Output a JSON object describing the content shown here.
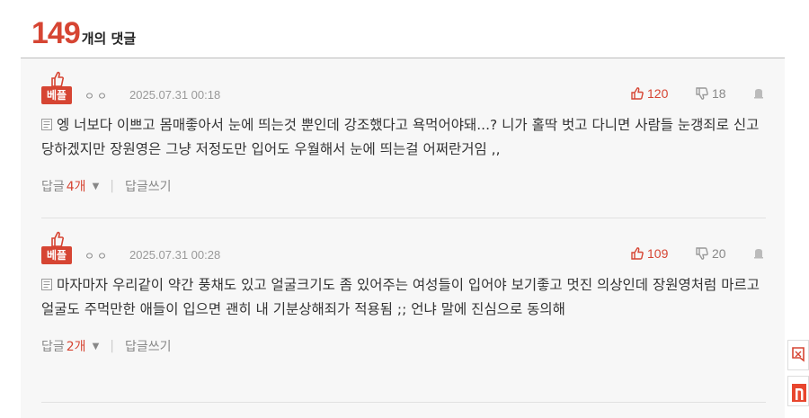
{
  "header": {
    "count": "149",
    "label": "개의 댓글"
  },
  "comments": [
    {
      "badge": "베플",
      "nickname": "ㅇㅇ",
      "date": "2025.07.31 00:18",
      "up": "120",
      "down": "18",
      "text": "엥 너보다 이쁘고 몸매좋아서 눈에 띄는것 뿐인데 강조했다고 욕먹어야돼...? 니가 홀딱 벗고 다니면 사람들 눈갱죄로 신고당하겠지만 장원영은 그냥 저정도만 입어도 우월해서 눈에 띄는걸 어쩌란거임 ,,",
      "reply_label": "답글",
      "reply_count": "4개",
      "write_label": "답글쓰기"
    },
    {
      "badge": "베플",
      "nickname": "ㅇㅇ",
      "date": "2025.07.31 00:28",
      "up": "109",
      "down": "20",
      "text": "마자마자 우리같이 약간 풍채도 있고 얼굴크기도 좀 있어주는 여성들이 입어야 보기좋고 멋진 의상인데 장원영처럼 마르고 얼굴도 주먹만한 애들이 입으면 괜히 내 기분상해죄가 적용됨 ;; 언냐 말에 진심으로 동의해",
      "reply_label": "답글",
      "reply_count": "2개",
      "write_label": "답글쓰기"
    }
  ],
  "colors": {
    "accent": "#d64533",
    "panel": "#f7f7f7",
    "muted": "#999999"
  },
  "icons": [
    "thumbs-up-icon",
    "thumbs-down-icon",
    "report-icon",
    "memo-icon",
    "caret-down-icon",
    "chat-icon",
    "naver-icon"
  ]
}
